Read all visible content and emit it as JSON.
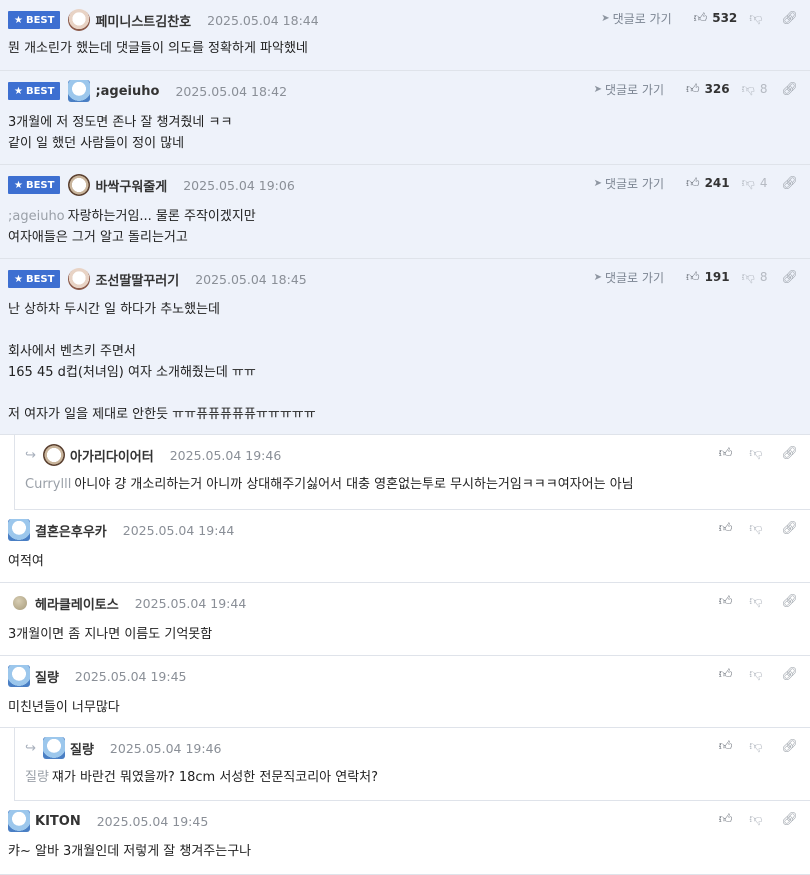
{
  "ui": {
    "best_label": "BEST",
    "goto_label": "댓글로 가기"
  },
  "comments": [
    {
      "best": true,
      "nick": "페미니스트김찬호",
      "date": "2025.05.04 18:44",
      "likes": "532",
      "dislikes": "",
      "lines": [
        "뭔 개소린가 했는데 댓글들이 의도를 정확하게 파악했네"
      ]
    },
    {
      "best": true,
      "nick": ";ageiuho",
      "date": "2025.05.04 18:42",
      "likes": "326",
      "dislikes": "8",
      "lines": [
        "3개월에 저 정도면 존나 잘 챙겨줬네 ㅋㅋ",
        "같이 일 했던 사람들이 정이 많네"
      ]
    },
    {
      "best": true,
      "nick": "바싹구워줄게",
      "date": "2025.05.04 19:06",
      "likes": "241",
      "dislikes": "4",
      "ref": ";ageiuho",
      "lines": [
        "자랑하는거임... 물론 주작이겠지만",
        "여자애들은 그거 알고 돌리는거고"
      ]
    },
    {
      "best": true,
      "nick": "조선딸딸꾸러기",
      "date": "2025.05.04 18:45",
      "likes": "191",
      "dislikes": "8",
      "lines": [
        "난 상하차 두시간 일 하다가 추노했는데",
        "",
        "회사에서 벤츠키 주면서",
        "165 45 d컵(처녀임) 여자 소개해줬는데 ㅠㅠ",
        "",
        "저 여자가 일을 제대로 안한듯 ㅠㅠ퓨퓨퓨퓨퓨ㅠㅠㅠㅠㅠ"
      ]
    },
    {
      "reply": true,
      "nick": "아가리다이어터",
      "date": "2025.05.04 19:46",
      "ref": "Currylll",
      "lines": [
        "아니야 걍 개소리하는거 아니까 상대해주기싫어서 대충 영혼없는투로 무시하는거임ㅋㅋㅋ여자어는 아님"
      ]
    },
    {
      "nick": "결혼은후우카",
      "date": "2025.05.04 19:44",
      "lines": [
        "여적여"
      ]
    },
    {
      "nick": "헤라클레이토스",
      "date": "2025.05.04 19:44",
      "lines": [
        "3개월이면 좀 지나면 이름도 기억못함"
      ]
    },
    {
      "nick": "질량",
      "date": "2025.05.04 19:45",
      "lines": [
        "미친년들이 너무많다"
      ]
    },
    {
      "reply": true,
      "nick": "질량",
      "date": "2025.05.04 19:46",
      "ref": "질량",
      "lines": [
        "쟤가 바란건 뭐였을까? 18cm 서성한 전문직코리아 연락처?"
      ]
    },
    {
      "nick": "KITON",
      "date": "2025.05.04 19:45",
      "lines": [
        "캬~ 알바 3개월인데 저렇게 잘 챙겨주는구나"
      ]
    }
  ],
  "icons": {
    "goto": "paper-plane-icon",
    "like": "thumbs-up-icon",
    "dislike": "thumbs-down-icon",
    "link": "link-icon"
  }
}
